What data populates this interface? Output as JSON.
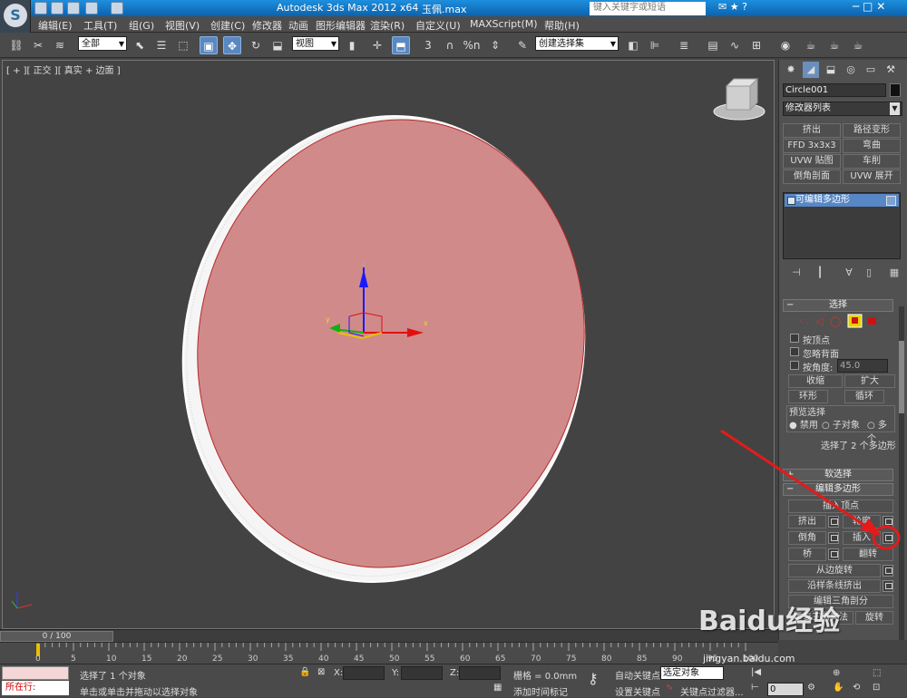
{
  "titlebar": {
    "app_title": "Autodesk 3ds Max  2012 x64",
    "file_name": "玉佩.max",
    "search_placeholder": "键入关键字或短语"
  },
  "menu": [
    "编辑(E)",
    "工具(T)",
    "组(G)",
    "视图(V)",
    "创建(C)",
    "修改器",
    "动画",
    "图形编辑器",
    "渲染(R)",
    "自定义(U)",
    "MAXScript(M)",
    "帮助(H)"
  ],
  "toolbar": {
    "filter_value": "全部",
    "refcoord_value": "视图",
    "selection_set_value": "创建选择集",
    "snap_3": "3",
    "snap_angle": "%n"
  },
  "viewport": {
    "label": "[ + ][ 正交 ][ 真实 + 边面 ]",
    "axis_x": "x",
    "axis_y": "y",
    "axis_z": "z"
  },
  "panel": {
    "object_name": "Circle001",
    "modifier_list": "修改器列表",
    "modifier_buttons": [
      "挤出",
      "路径变形",
      "FFD 3x3x3",
      "弯曲",
      "UVW 贴图",
      "车削",
      "倒角剖面",
      "UVW 展开"
    ],
    "stack_item": "可编辑多边形",
    "selection": {
      "title": "选择",
      "by_vertex": "按顶点",
      "ignore_backface": "忽略背面",
      "by_angle": "按角度:",
      "angle_value": "45.0",
      "shrink": "收缩",
      "grow": "扩大",
      "ring": "环形",
      "loop": "循环",
      "preview_title": "预览选择",
      "preview_off": "禁用",
      "preview_subobj": "子对象",
      "preview_multi": "多个",
      "status": "选择了 2 个多边形"
    },
    "soft_selection": "软选择",
    "edit_polygons": {
      "title": "编辑多边形",
      "insert_vertex": "插入顶点",
      "extrude": "挤出",
      "outline": "轮廓",
      "bevel": "倒角",
      "inset": "插入",
      "bridge": "桥",
      "flip": "翻转",
      "hinge_from_edge": "从边旋转",
      "extrude_along_spline": "沿样条线挤出",
      "edit_triangulation": "编辑三角剖分",
      "retriangulate": "重复三角算法",
      "turn": "旋转"
    }
  },
  "timeline": {
    "slider": "0 / 100",
    "ticks": [
      "0",
      "5",
      "10",
      "15",
      "20",
      "25",
      "30",
      "35",
      "40",
      "45",
      "50",
      "55",
      "60",
      "65",
      "70",
      "75",
      "80",
      "85",
      "90",
      "95",
      "100"
    ]
  },
  "status": {
    "selected": "选择了 1 个对象",
    "prompt": "单击或单击并拖动以选择对象",
    "running": "所在行:",
    "x_label": "X:",
    "y_label": "Y:",
    "z_label": "Z:",
    "grid": "栅格 = 0.0mm",
    "add_time_tag": "添加时间标记",
    "auto_key": "自动关键点",
    "selected_obj": "选定对象",
    "set_key": "设置关键点",
    "key_filters": "关键点过滤器...",
    "frame": "0"
  },
  "watermark": {
    "logo": "Baidu经验",
    "url": "jingyan.baidu.com"
  },
  "colors": {
    "accent": "#5787c6",
    "disc_face": "#d18a8a",
    "annotation": "#e41b1b"
  }
}
